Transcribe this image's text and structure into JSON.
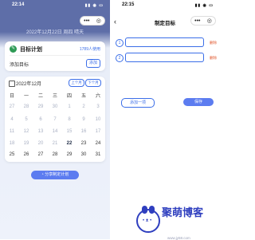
{
  "left": {
    "status_time": "22:14",
    "date_line": "2022年12月22日 周四 晴天",
    "goal_card": {
      "title": "目标计划",
      "users": "1789人使用",
      "add_label": "添加目标",
      "add_button": "添加"
    },
    "calendar": {
      "month": "2022年12月",
      "prev": "上个月",
      "next": "下个月",
      "weekdays": [
        "日",
        "一",
        "二",
        "三",
        "四",
        "五",
        "六"
      ],
      "days": [
        [
          "27",
          "28",
          "29",
          "30",
          "1",
          "2",
          "3"
        ],
        [
          "4",
          "5",
          "6",
          "7",
          "8",
          "9",
          "10"
        ],
        [
          "11",
          "12",
          "13",
          "14",
          "15",
          "16",
          "17"
        ],
        [
          "18",
          "19",
          "20",
          "21",
          "22",
          "23",
          "24"
        ],
        [
          "25",
          "26",
          "27",
          "28",
          "29",
          "30",
          "31"
        ]
      ],
      "today": "22"
    },
    "share_button": "分享制定计划"
  },
  "right": {
    "status_time": "22:15",
    "title": "制定目标",
    "rows": [
      {
        "num": "1",
        "delete": "删除"
      },
      {
        "num": "2",
        "delete": "删除"
      }
    ],
    "add_item_button": "添加一项",
    "save_button": "保存"
  },
  "watermark": {
    "brand": "聚萌博客",
    "url": "www.jy58.com"
  }
}
